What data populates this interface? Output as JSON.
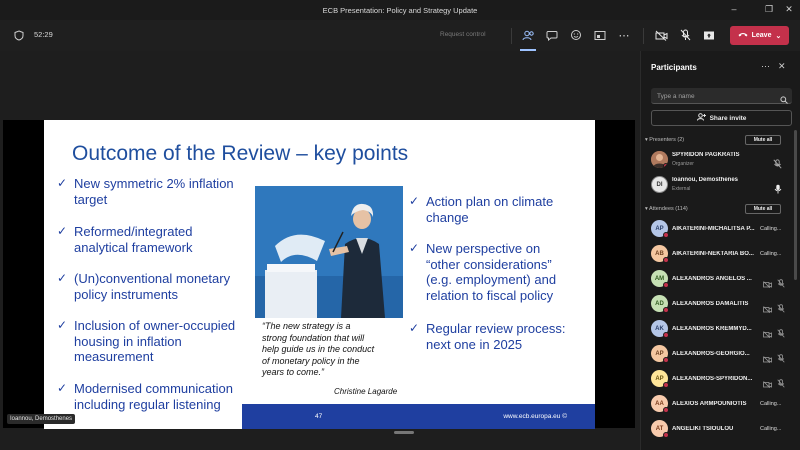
{
  "window": {
    "title": "ECB Presentation: Policy and Strategy Update"
  },
  "meeting": {
    "timer": "52:29",
    "request_control": "Request control",
    "leave_label": "Leave",
    "leave_color": "#c4314b"
  },
  "slide": {
    "title": "Outcome of the Review – key points",
    "left_bullets": [
      [
        "New symmetric 2% inflation",
        "target"
      ],
      [
        "Reformed/integrated",
        "analytical framework"
      ],
      [
        "(Un)conventional monetary",
        "policy instruments"
      ],
      [
        "Inclusion of owner-occupied",
        "housing in inflation",
        "measurement"
      ],
      [
        "Modernised communication",
        "including regular listening"
      ]
    ],
    "right_bullets": [
      [
        "Action plan on climate",
        "change"
      ],
      [
        "New perspective on",
        "“other considerations”",
        "(e.g. employment) and",
        "relation to fiscal policy"
      ],
      [
        "Regular review process:",
        "next one in 2025"
      ]
    ],
    "quote": [
      "“The new strategy is a",
      "strong foundation that will",
      "help guide us in the conduct",
      "of monetary policy in the",
      "years to come.”"
    ],
    "quote_author": "Christine Lagarde",
    "page_number": "47",
    "url": "www.ecb.europa.eu ©",
    "brand_color": "#1f3fa0"
  },
  "sharer_label": "Ioannou, Demosthenes",
  "panel": {
    "title": "Participants",
    "search_placeholder": "Type a name",
    "share_invite": "Share invite",
    "presenters_label": "Presenters (2)",
    "attendees_label": "Attendees (114)",
    "mute_all": "Mute all",
    "presenters": [
      {
        "name": "SPYRIDON PAGKRATIS",
        "role": "Organizer",
        "initials": "",
        "avatar_color": "#8a5a44",
        "mic": "muted"
      },
      {
        "name": "Ioannou, Demosthenes",
        "role": "External",
        "initials": "DI",
        "avatar_color": "#e8e8e8",
        "mic": "on"
      }
    ],
    "attendees": [
      {
        "name": "AIKATERINI-MICHALITSA P...",
        "initials": "AP",
        "color": "#b4c6e7",
        "status": "Calling..."
      },
      {
        "name": "AIKATERINI-NEKTARIA BO...",
        "initials": "AB",
        "color": "#f4c7a1",
        "status": "Calling..."
      },
      {
        "name": "ALEXANDROS ANGELOS ...",
        "initials": "AM",
        "color": "#c6e0b4",
        "status": ""
      },
      {
        "name": "ALEXANDROS DAMALITIS",
        "initials": "AD",
        "color": "#c6e0b4",
        "status": ""
      },
      {
        "name": "ALEXANDROS KREMMYD...",
        "initials": "AK",
        "color": "#b4c6e7",
        "status": ""
      },
      {
        "name": "ALEXANDROS-GEORGIO...",
        "initials": "AP",
        "color": "#f4c7a1",
        "status": ""
      },
      {
        "name": "ALEXANDROS-SPYRIDON...",
        "initials": "AP",
        "color": "#ffe699",
        "status": ""
      },
      {
        "name": "ALEXIOS ARMPOUNIOTIS",
        "initials": "AA",
        "color": "#f8cbad",
        "status": "Calling..."
      },
      {
        "name": "ANGELIKI TSIOULOU",
        "initials": "AT",
        "color": "#f8cbad",
        "status": "Calling..."
      }
    ]
  }
}
